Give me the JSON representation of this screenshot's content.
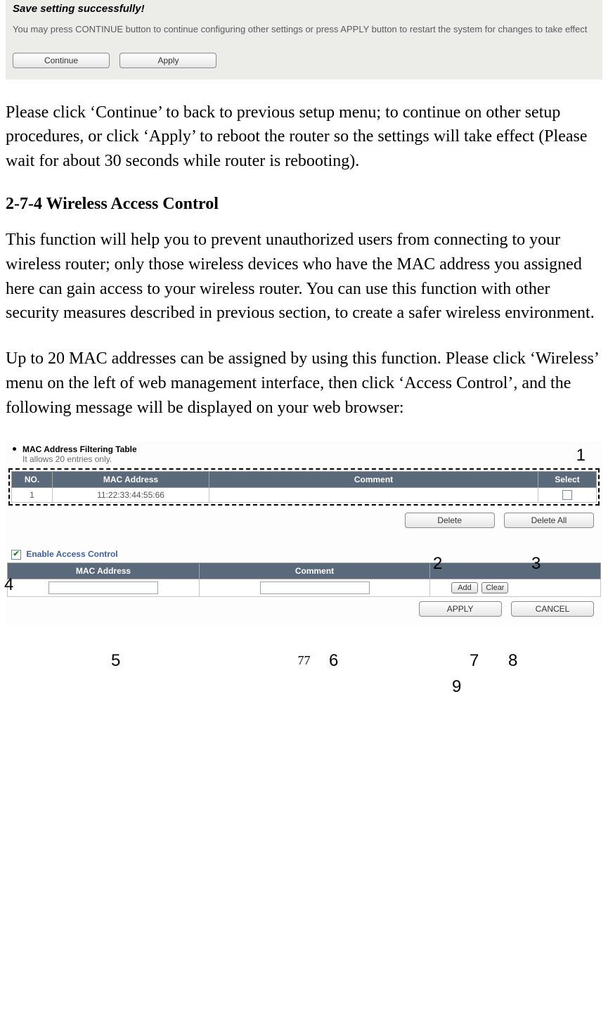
{
  "save_box": {
    "title": "Save setting successfully!",
    "text": "You may press CONTINUE button to continue configuring other settings or press APPLY button to restart the system for changes to take effect",
    "continue_label": "Continue",
    "apply_label": "Apply"
  },
  "para1": "Please click ‘Continue’ to back to previous setup menu; to continue on other setup procedures, or click ‘Apply’ to reboot the router so the settings will take effect (Please wait for about 30 seconds while router is rebooting).",
  "section_title": "2-7-4 Wireless Access Control",
  "para2": "This function will help you to prevent unauthorized users from connecting to your wireless router; only those wireless devices who have the MAC address you assigned here can gain access to your wireless router. You can use this function with other security measures described in previous section, to create a safer wireless environment.",
  "para3": "Up to 20 MAC addresses can be assigned by using this function. Please click ‘Wireless’ menu on the left of web management interface, then click ‘Access Control’, and the following message will be displayed on your web browser:",
  "filter_table": {
    "title": "MAC Address Filtering Table",
    "subtitle": "It allows 20 entries only.",
    "headers": {
      "no": "NO.",
      "mac": "MAC Address",
      "comment": "Comment",
      "select": "Select"
    },
    "rows": [
      {
        "no": "1",
        "mac": "11:22:33:44:55:66",
        "comment": "",
        "select": false
      }
    ],
    "delete_label": "Delete",
    "delete_all_label": "Delete All"
  },
  "enable_label": "Enable Access Control",
  "add_table": {
    "headers": {
      "mac": "MAC Address",
      "comment": "Comment"
    },
    "add_label": "Add",
    "clear_label": "Clear",
    "apply_label": "APPLY",
    "cancel_label": "CANCEL"
  },
  "callouts": {
    "c1": "1",
    "c2": "2",
    "c3": "3",
    "c4": "4",
    "c5": "5",
    "c6": "6",
    "c7": "7",
    "c8": "8",
    "c9": "9"
  },
  "page_number": "77"
}
